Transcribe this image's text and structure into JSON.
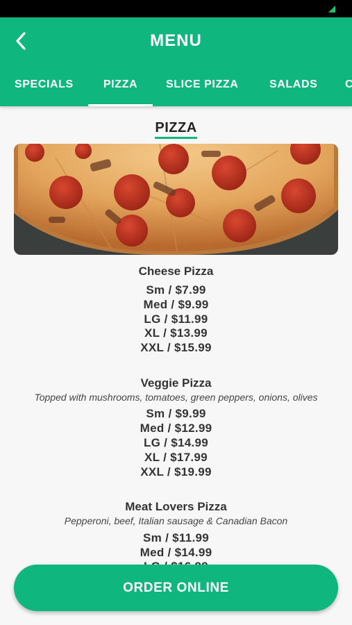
{
  "header": {
    "title": "MENU"
  },
  "tabs": [
    "SPECIALS",
    "PIZZA",
    "SLICE PIZZA",
    "SALADS",
    "C"
  ],
  "active_tab": "PIZZA",
  "section": {
    "title": "PIZZA"
  },
  "items": [
    {
      "name": "Cheese Pizza",
      "description": "",
      "prices": [
        "Sm / $7.99",
        "Med / $9.99",
        "LG / $11.99",
        "XL / $13.99",
        "XXL / $15.99"
      ]
    },
    {
      "name": "Veggie Pizza",
      "description": "Topped with mushrooms, tomatoes, green peppers, onions, olives",
      "prices": [
        "Sm / $9.99",
        "Med / $12.99",
        "LG / $14.99",
        "XL / $17.99",
        "XXL / $19.99"
      ]
    },
    {
      "name": "Meat Lovers Pizza",
      "description": "Pepperoni, beef, Italian sausage & Canadian Bacon",
      "prices": [
        "Sm / $11.99",
        "Med / $14.99",
        "LG / $16.99"
      ]
    }
  ],
  "order_button": {
    "label": "ORDER ONLINE"
  },
  "colors": {
    "brand": "#0fb67d",
    "status_bar": "#000000",
    "background": "#f7f7f7"
  }
}
